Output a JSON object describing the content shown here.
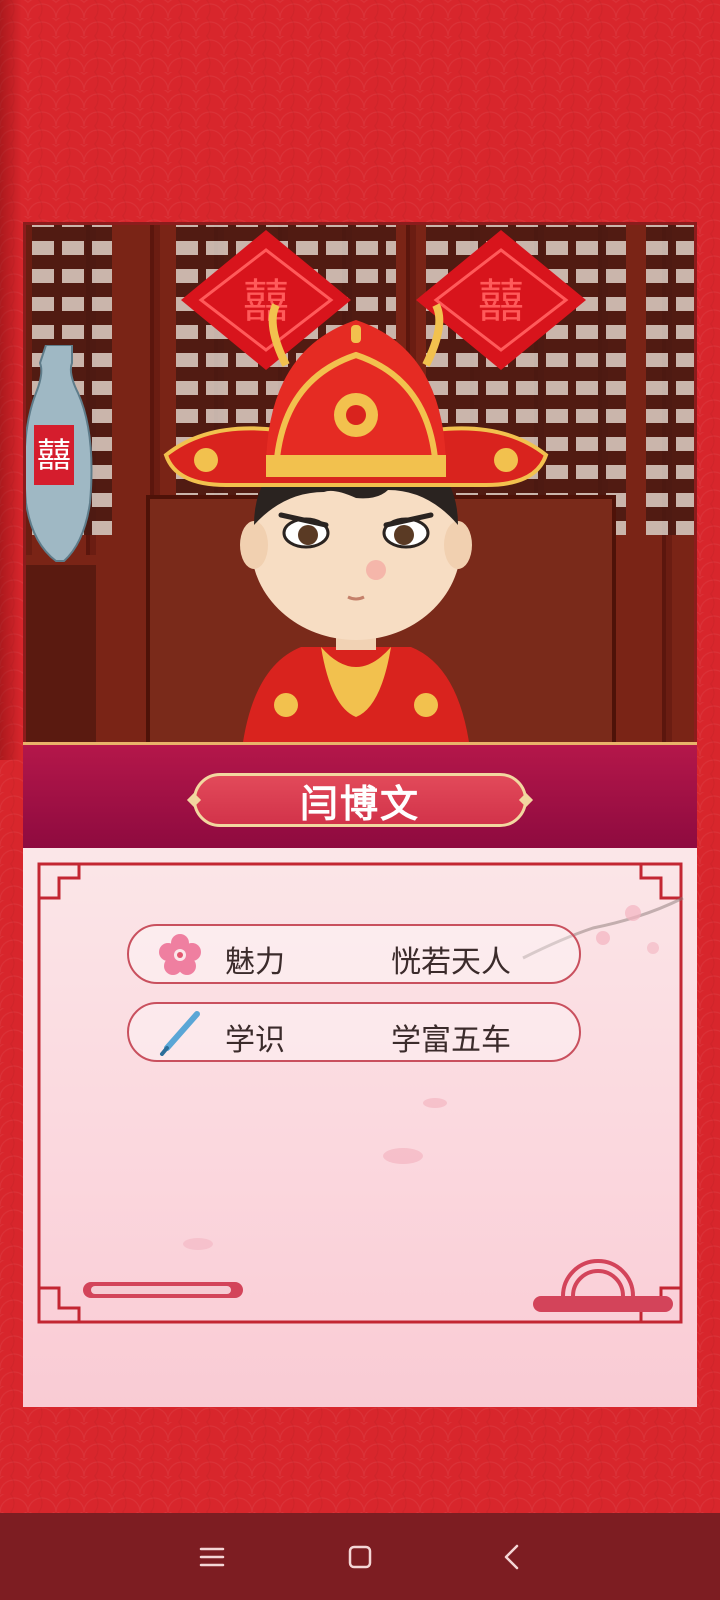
{
  "character": {
    "name": "闫博文",
    "stats": [
      {
        "icon": "plum-blossom-icon",
        "label": "魅力",
        "value": "恍若天人"
      },
      {
        "icon": "brush-pen-icon",
        "label": "学识",
        "value": "学富五车"
      }
    ]
  },
  "colors": {
    "background": "#d8262c",
    "banner": "#a9124a",
    "panel": "#fbe0e5",
    "accent": "#c9505e",
    "navbar": "#7d1d22"
  },
  "navbar": {
    "buttons": [
      "menu-icon",
      "home-icon",
      "back-icon"
    ]
  }
}
